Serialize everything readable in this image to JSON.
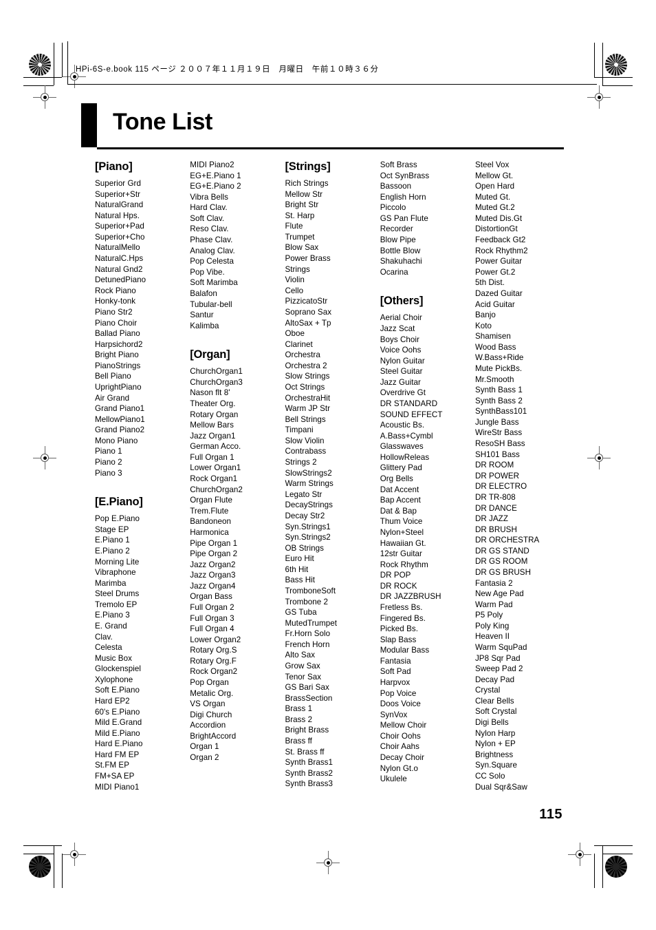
{
  "document": {
    "file_header": "HPi-6S-e.book  115 ページ  ２００７年１１月１９日　月曜日　午前１０時３６分",
    "title": "Tone List",
    "page_number": "115"
  },
  "columns": [
    {
      "blocks": [
        {
          "heading": "[Piano]",
          "items": [
            "Superior Grd",
            "Superior+Str",
            "NaturalGrand",
            "Natural Hps.",
            "Superior+Pad",
            "Superior+Cho",
            "NaturalMello",
            "NaturalC.Hps",
            "Natural Gnd2",
            "DetunedPiano",
            "Rock Piano",
            "Honky-tonk",
            "Piano Str2",
            "Piano Choir",
            "Ballad Piano",
            "Harpsichord2",
            "Bright Piano",
            "PianoStrings",
            "Bell Piano",
            "UprightPiano",
            "Air Grand",
            "Grand Piano1",
            "MellowPiano1",
            "Grand Piano2",
            "Mono Piano",
            "Piano 1",
            "Piano 2",
            "Piano 3"
          ]
        },
        {
          "heading": "[E.Piano]",
          "items": [
            "Pop E.Piano",
            "Stage EP",
            "E.Piano 1",
            "E.Piano 2",
            "Morning Lite",
            "Vibraphone",
            "Marimba",
            "Steel Drums",
            "Tremolo EP",
            "E.Piano 3",
            "E. Grand",
            "Clav.",
            "Celesta",
            "Music Box",
            "Glockenspiel",
            "Xylophone",
            "Soft E.Piano",
            "Hard EP2",
            "60's E.Piano",
            "Mild E.Grand",
            "Mild E.Piano",
            "Hard E.Piano",
            "Hard FM EP",
            "St.FM EP",
            "FM+SA EP",
            "MIDI Piano1"
          ]
        }
      ]
    },
    {
      "blocks": [
        {
          "heading": "",
          "items": [
            "MIDI Piano2",
            "EG+E.Piano 1",
            "EG+E.Piano 2",
            "Vibra Bells",
            "Hard Clav.",
            "Soft Clav.",
            "Reso Clav.",
            "Phase Clav.",
            "Analog Clav.",
            "Pop Celesta",
            "Pop Vibe.",
            "Soft Marimba",
            "Balafon",
            "Tubular-bell",
            "Santur",
            "Kalimba"
          ]
        },
        {
          "heading": "[Organ]",
          "items": [
            "ChurchOrgan1",
            "ChurchOrgan3",
            "Nason flt 8'",
            "Theater Org.",
            "Rotary Organ",
            "Mellow Bars",
            "Jazz Organ1",
            "German Acco.",
            "Full Organ 1",
            "Lower Organ1",
            "Rock Organ1",
            "ChurchOrgan2",
            "Organ Flute",
            "Trem.Flute",
            "Bandoneon",
            "Harmonica",
            "Pipe Organ 1",
            "Pipe Organ 2",
            "Jazz Organ2",
            "Jazz Organ3",
            "Jazz Organ4",
            "Organ Bass",
            "Full Organ 2",
            "Full Organ 3",
            "Full Organ 4",
            "Lower Organ2",
            "Rotary Org.S",
            "Rotary Org.F",
            "Rock Organ2",
            "Pop Organ",
            "Metalic Org.",
            "VS Organ",
            "Digi Church",
            "Accordion",
            "BrightAccord",
            "Organ 1",
            "Organ 2"
          ]
        }
      ]
    },
    {
      "blocks": [
        {
          "heading": "[Strings]",
          "items": [
            "Rich Strings",
            "Mellow Str",
            "Bright Str",
            "St. Harp",
            "Flute",
            "Trumpet",
            "Blow Sax",
            "Power Brass",
            "Strings",
            "Violin",
            "Cello",
            "PizzicatoStr",
            "Soprano Sax",
            "AltoSax + Tp",
            "Oboe",
            "Clarinet",
            "Orchestra",
            "Orchestra 2",
            "Slow Strings",
            "Oct Strings",
            "OrchestraHit",
            "Warm JP Str",
            "Bell Strings",
            "Timpani",
            "Slow Violin",
            "Contrabass",
            "Strings 2",
            "SlowStrings2",
            "Warm Strings",
            "Legato Str",
            "DecayStrings",
            "Decay Str2",
            "Syn.Strings1",
            "Syn.Strings2",
            "OB Strings",
            "Euro Hit",
            "6th Hit",
            "Bass Hit",
            "TromboneSoft",
            "Trombone 2",
            "GS Tuba",
            "MutedTrumpet",
            "Fr.Horn Solo",
            "French Horn",
            "Alto Sax",
            "Grow Sax",
            "Tenor Sax",
            "GS Bari Sax",
            "BrassSection",
            "Brass 1",
            "Brass 2",
            "Bright Brass",
            "Brass ff",
            "St. Brass ff",
            "Synth Brass1",
            "Synth Brass2",
            "Synth Brass3"
          ]
        }
      ]
    },
    {
      "blocks": [
        {
          "heading": "",
          "items": [
            "Soft Brass",
            "Oct SynBrass",
            "Bassoon",
            "English Horn",
            "Piccolo",
            "GS Pan Flute",
            "Recorder",
            "Blow Pipe",
            "Bottle Blow",
            "Shakuhachi",
            "Ocarina"
          ]
        },
        {
          "heading": "[Others]",
          "items": [
            "Aerial Choir",
            "Jazz Scat",
            "Boys Choir",
            "Voice Oohs",
            "Nylon Guitar",
            "Steel Guitar",
            "Jazz Guitar",
            "Overdrive Gt",
            "DR STANDARD",
            "SOUND EFFECT",
            "Acoustic Bs.",
            "A.Bass+Cymbl",
            "Glasswaves",
            "HollowReleas",
            "Glittery Pad",
            "Org Bells",
            "Dat Accent",
            "Bap Accent",
            "Dat & Bap",
            "Thum Voice",
            "Nylon+Steel",
            "Hawaiian Gt.",
            "12str Guitar",
            "Rock Rhythm",
            "DR POP",
            "DR ROCK",
            "DR JAZZBRUSH",
            "Fretless Bs.",
            "Fingered Bs.",
            "Picked Bs.",
            "Slap Bass",
            "Modular Bass",
            "Fantasia",
            "Soft Pad",
            "Harpvox",
            "Pop Voice",
            "Doos Voice",
            "SynVox",
            "Mellow Choir",
            "Choir Oohs",
            "Choir Aahs",
            "Decay Choir",
            "Nylon Gt.o",
            "Ukulele"
          ]
        }
      ]
    },
    {
      "blocks": [
        {
          "heading": "",
          "items": [
            "Steel Vox",
            "Mellow Gt.",
            "Open Hard",
            "Muted Gt.",
            "Muted Gt.2",
            "Muted Dis.Gt",
            "DistortionGt",
            "Feedback Gt2",
            "Rock Rhythm2",
            "Power Guitar",
            "Power Gt.2",
            "5th Dist.",
            "Dazed Guitar",
            "Acid Guitar",
            "Banjo",
            "Koto",
            "Shamisen",
            "Wood Bass",
            "W.Bass+Ride",
            "Mute PickBs.",
            "Mr.Smooth",
            "Synth Bass 1",
            "Synth Bass 2",
            "SynthBass101",
            "Jungle Bass",
            "WireStr Bass",
            "ResoSH Bass",
            "SH101 Bass",
            "DR ROOM",
            "DR POWER",
            "DR ELECTRO",
            "DR TR-808",
            "DR DANCE",
            "DR JAZZ",
            "DR BRUSH",
            "DR ORCHESTRA",
            "DR GS STAND",
            "DR GS ROOM",
            "DR GS BRUSH",
            "Fantasia 2",
            "New Age Pad",
            "Warm Pad",
            "P5 Poly",
            "Poly King",
            "Heaven II",
            "Warm SquPad",
            "JP8 Sqr Pad",
            "Sweep Pad 2",
            "Decay Pad",
            "Crystal",
            "Clear Bells",
            "Soft Crystal",
            "Digi Bells",
            "Nylon Harp",
            "Nylon + EP",
            "Brightness",
            "Syn.Square",
            "CC Solo",
            "Dual Sqr&Saw"
          ]
        }
      ]
    }
  ]
}
